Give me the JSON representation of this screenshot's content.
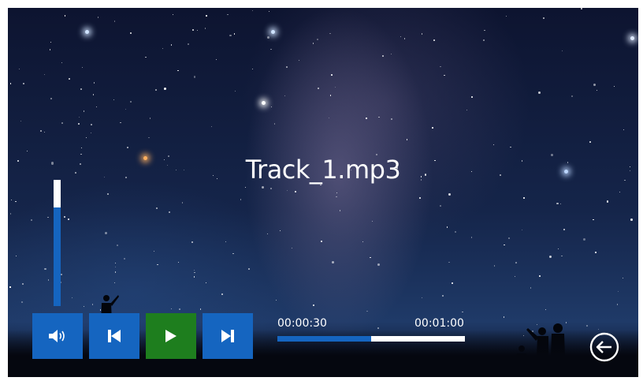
{
  "player": {
    "track_title": "Track_1.mp3",
    "current_time": "00:00:30",
    "total_time": "00:01:00",
    "progress_fraction": 0.5,
    "volume_level": 0.78
  },
  "controls": {
    "volume_icon": "speaker-icon",
    "previous_icon": "skip-previous-icon",
    "play_icon": "play-icon",
    "next_icon": "skip-next-icon",
    "back_icon": "back-arrow-circle-icon"
  },
  "colors": {
    "accent_blue": "#1565c0",
    "play_green": "#1e7e1e",
    "text": "#ffffff"
  }
}
